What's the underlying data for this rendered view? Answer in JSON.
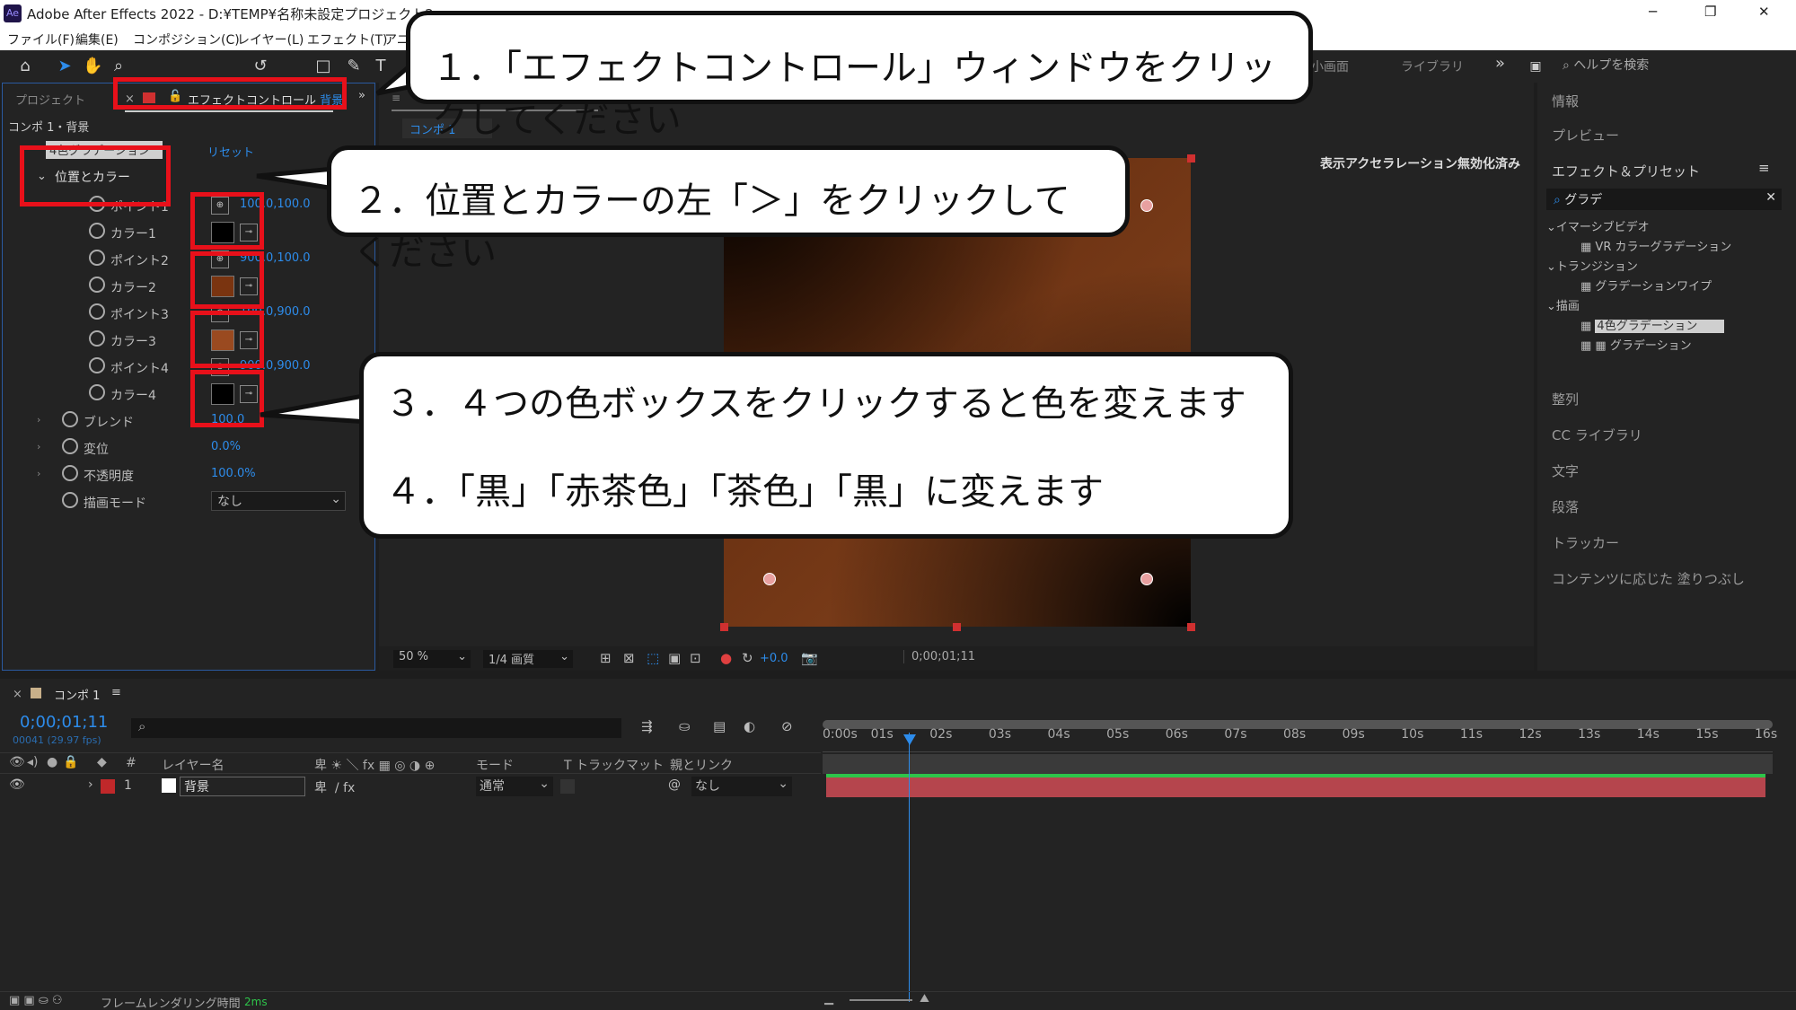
{
  "window": {
    "title": "Adobe After Effects 2022 - D:¥TEMP¥名称未設定プロジェクト2.aep",
    "app_icon": "Ae",
    "controls": [
      "─",
      "❐",
      "✕"
    ]
  },
  "menu": [
    "ファイル(F)",
    "編集(E)",
    "コンポジション(C)",
    "レイヤー(L)",
    "エフェクト(T)",
    "アニ"
  ],
  "toolbar": {
    "right_tabs": [
      "小画面",
      "ライブラリ"
    ],
    "overflow": "»",
    "help_placeholder": "ヘルプを検索"
  },
  "left_panel": {
    "tab_project": "プロジェクト",
    "tab_effect": "エフェクトコントロール",
    "tab_effect_layer": "背景",
    "breadcrumb": "コンポ 1・背景",
    "effect_name": "4色グラデーション",
    "reset": "リセット",
    "group": "位置とカラー",
    "props": [
      {
        "name": "ポイント1",
        "value": "100.0,100.0"
      },
      {
        "name": "カラー1",
        "color": "#000000"
      },
      {
        "name": "ポイント2",
        "value": "900.0,100.0"
      },
      {
        "name": "カラー2",
        "color": "#7a3410"
      },
      {
        "name": "ポイント3",
        "value": "100.0,900.0"
      },
      {
        "name": "カラー3",
        "color": "#9a4a20"
      },
      {
        "name": "ポイント4",
        "value": "900.0,900.0"
      },
      {
        "name": "カラー4",
        "color": "#000000"
      }
    ],
    "blend": "ブレンド",
    "blend_value": "100.0",
    "jitter": "変位",
    "jitter_value": "0.0%",
    "opacity": "不透明度",
    "opacity_value": "100.0%",
    "mode": "描画モード",
    "mode_value": "なし"
  },
  "viewer": {
    "tab": "コンポ 1",
    "accel": "表示アクセラレーション無効化済み",
    "zoom": "50 %",
    "resolution": "1/4 画質",
    "exposure": "+0.0",
    "timecode": "0;00;01;11"
  },
  "right_panel": {
    "info": "情報",
    "preview": "プレビュー",
    "effects": "エフェクト＆プリセット",
    "search": "グラデ",
    "tree": [
      {
        "cat": "イマーシブビデオ",
        "item": "VR カラーグラデーション"
      },
      {
        "cat": "トランジション",
        "item": "グラデーションワイプ"
      },
      {
        "cat": "描画",
        "items": [
          "4色グラデーション",
          "グラデーション"
        ]
      }
    ],
    "panels": [
      "整列",
      "CC ライブラリ",
      "文字",
      "段落",
      "トラッカー",
      "コンテンツに応じた 塗りつぶし"
    ]
  },
  "timeline": {
    "tab": "コンポ 1",
    "timecode": "0;00;01;11",
    "frames": "00041 (29.97 fps)",
    "headers": {
      "name": "レイヤー名",
      "mode": "モード",
      "track": "T  トラックマット",
      "parent": "親とリンク"
    },
    "layer": {
      "num": "1",
      "name": "背景",
      "mode": "通常",
      "parent": "なし"
    },
    "ticks": [
      "0:00s",
      "01s",
      "02s",
      "03s",
      "04s",
      "05s",
      "06s",
      "07s",
      "08s",
      "09s",
      "10s",
      "11s",
      "12s",
      "13s",
      "14s",
      "15s",
      "16s"
    ],
    "footer": "フレームレンダリング時間",
    "footer_ms": "2ms"
  },
  "callouts": {
    "c1": "１．「エフェクトコントロール」ウィンドウをクリックしてください",
    "c2": "２．位置とカラーの左「＞」をクリックしてください",
    "c3": "３．４つの色ボックスをクリックすると色を変えます",
    "c4": "４．「黒」「赤茶色」「茶色」「黒」に変えます"
  },
  "colors": {
    "accent": "#2d8ceb",
    "highlight": "#e8101a",
    "track": "#b5454d"
  }
}
